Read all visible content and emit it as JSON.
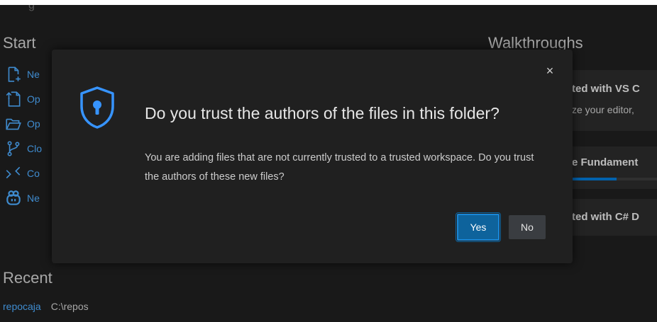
{
  "welcome": {
    "start_title": "Start",
    "start_items": [
      {
        "label": "Ne",
        "icon": "new-file-icon"
      },
      {
        "label": "Op",
        "icon": "open-file-icon"
      },
      {
        "label": "Op",
        "icon": "open-folder-icon"
      },
      {
        "label": "Clo",
        "icon": "git-clone-icon"
      },
      {
        "label": "Co",
        "icon": "remote-connect-icon"
      },
      {
        "label": "Ne",
        "icon": "copilot-icon"
      }
    ],
    "recent_title": "Recent",
    "recent": [
      {
        "name": "repocaja",
        "path": "C:\\repos"
      }
    ],
    "walkthroughs_title": "Walkthroughs",
    "walkthroughs": [
      {
        "title": "ted with VS C",
        "desc": "ze your editor,"
      },
      {
        "title": "e Fundament",
        "progress": 0.45
      },
      {
        "title": "ted with C# D"
      }
    ]
  },
  "dialog": {
    "close_label": "×",
    "title": "Do you trust the authors of the files in this folder?",
    "message": "You are adding files that are not currently trusted to a trusted workspace. Do you trust the authors of these new files?",
    "yes_label": "Yes",
    "no_label": "No",
    "icon": "shield-keyhole-icon"
  },
  "colors": {
    "accent": "#0078d4",
    "link": "#4daafc",
    "background": "#1f1f1f",
    "dialog_bg": "#202020",
    "yes_button": "#0e639c"
  }
}
